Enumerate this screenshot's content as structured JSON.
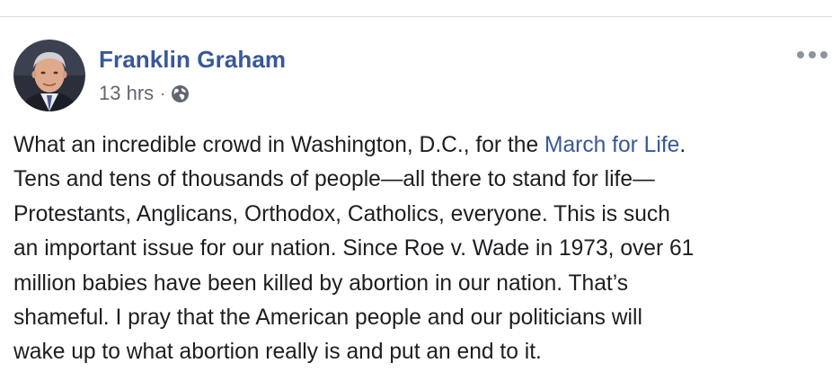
{
  "post": {
    "author": "Franklin Graham",
    "timestamp": "13 hrs",
    "separator": "·",
    "privacy_icon": "globe-icon",
    "more_icon": "more-options-icon",
    "text": {
      "line1_before": "What an incredible crowd in Washington, D.C., for the ",
      "line1_link": "March for Life",
      "line1_after": ".",
      "line2": "Tens and tens of thousands of people—all there to stand for life—",
      "line3": "Protestants, Anglicans, Orthodox, Catholics, everyone. This is such",
      "line4": "an important issue for our nation. Since Roe v. Wade in 1973, over 61",
      "line5": "million babies have been killed by abortion in our nation. That’s",
      "line6": "shameful. I pray that the American people and our politicians will",
      "line7": "wake up to what abortion really is and put an end to it."
    }
  },
  "colors": {
    "link": "#385898",
    "meta": "#606770",
    "text": "#1c1e21",
    "divider": "#dadde1"
  }
}
